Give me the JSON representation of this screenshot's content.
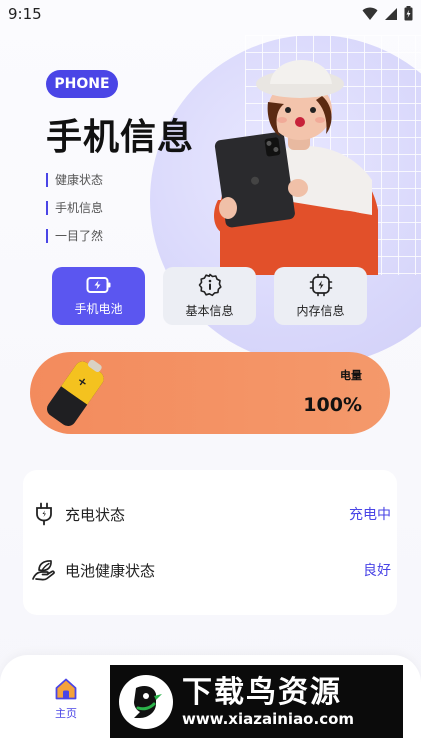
{
  "status": {
    "time": "9:15"
  },
  "header": {
    "badge": "PHONE",
    "title": "手机信息",
    "taglines": [
      "健康状态",
      "手机信息",
      "一目了然"
    ]
  },
  "tabs": [
    {
      "label": "手机电池",
      "icon": "battery-bolt-icon",
      "active": true
    },
    {
      "label": "基本信息",
      "icon": "info-icon",
      "active": false
    },
    {
      "label": "内存信息",
      "icon": "chip-icon",
      "active": false
    }
  ],
  "battery": {
    "label": "电量",
    "value": "100%"
  },
  "info": [
    {
      "label": "充电状态",
      "value": "充电中",
      "icon": "plug-icon"
    },
    {
      "label": "电池健康状态",
      "value": "良好",
      "icon": "leaf-hand-icon"
    }
  ],
  "nav": {
    "home_label": "主页",
    "home_icon": "home-icon"
  },
  "watermark": {
    "title": "下载鸟资源",
    "url": "www.xiazainiao.com"
  },
  "colors": {
    "accent": "#4a45e6",
    "battery": "#f38b5d",
    "background": "#f6f6fb"
  }
}
